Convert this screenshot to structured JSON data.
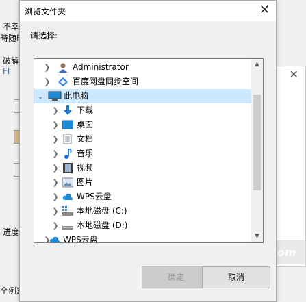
{
  "background": {
    "line1": "不幸",
    "line2": "時随时",
    "line3": "破解",
    "line4": "Fl",
    "progress_label": "进度",
    "bottom_left": "全例》",
    "watermark": "om"
  },
  "dialog": {
    "title": "浏览文件夹",
    "prompt": "请选择:",
    "tree": [
      {
        "label": "Administrator",
        "icon": "user-icon",
        "level": 1
      },
      {
        "label": "百度网盘同步空间",
        "icon": "baidu-cloud-icon",
        "level": 1
      },
      {
        "label": "此电脑",
        "icon": "computer-icon",
        "level": 1,
        "expanded": true,
        "selected": true
      },
      {
        "label": "下载",
        "icon": "download-icon",
        "level": 2
      },
      {
        "label": "桌面",
        "icon": "desktop-icon",
        "level": 2
      },
      {
        "label": "文档",
        "icon": "document-icon",
        "level": 2
      },
      {
        "label": "音乐",
        "icon": "music-icon",
        "level": 2
      },
      {
        "label": "视频",
        "icon": "video-icon",
        "level": 2
      },
      {
        "label": "图片",
        "icon": "picture-icon",
        "level": 2
      },
      {
        "label": "WPS云盘",
        "icon": "wps-cloud-icon",
        "level": 2
      },
      {
        "label": "本地磁盘 (C:)",
        "icon": "system-drive-icon",
        "level": 2
      },
      {
        "label": "本地磁盘 (D:)",
        "icon": "drive-icon",
        "level": 2
      },
      {
        "label": "WPS云盘",
        "icon": "wps-cloud-icon",
        "level": 1
      }
    ],
    "ok_label": "确定",
    "cancel_label": "取消"
  }
}
